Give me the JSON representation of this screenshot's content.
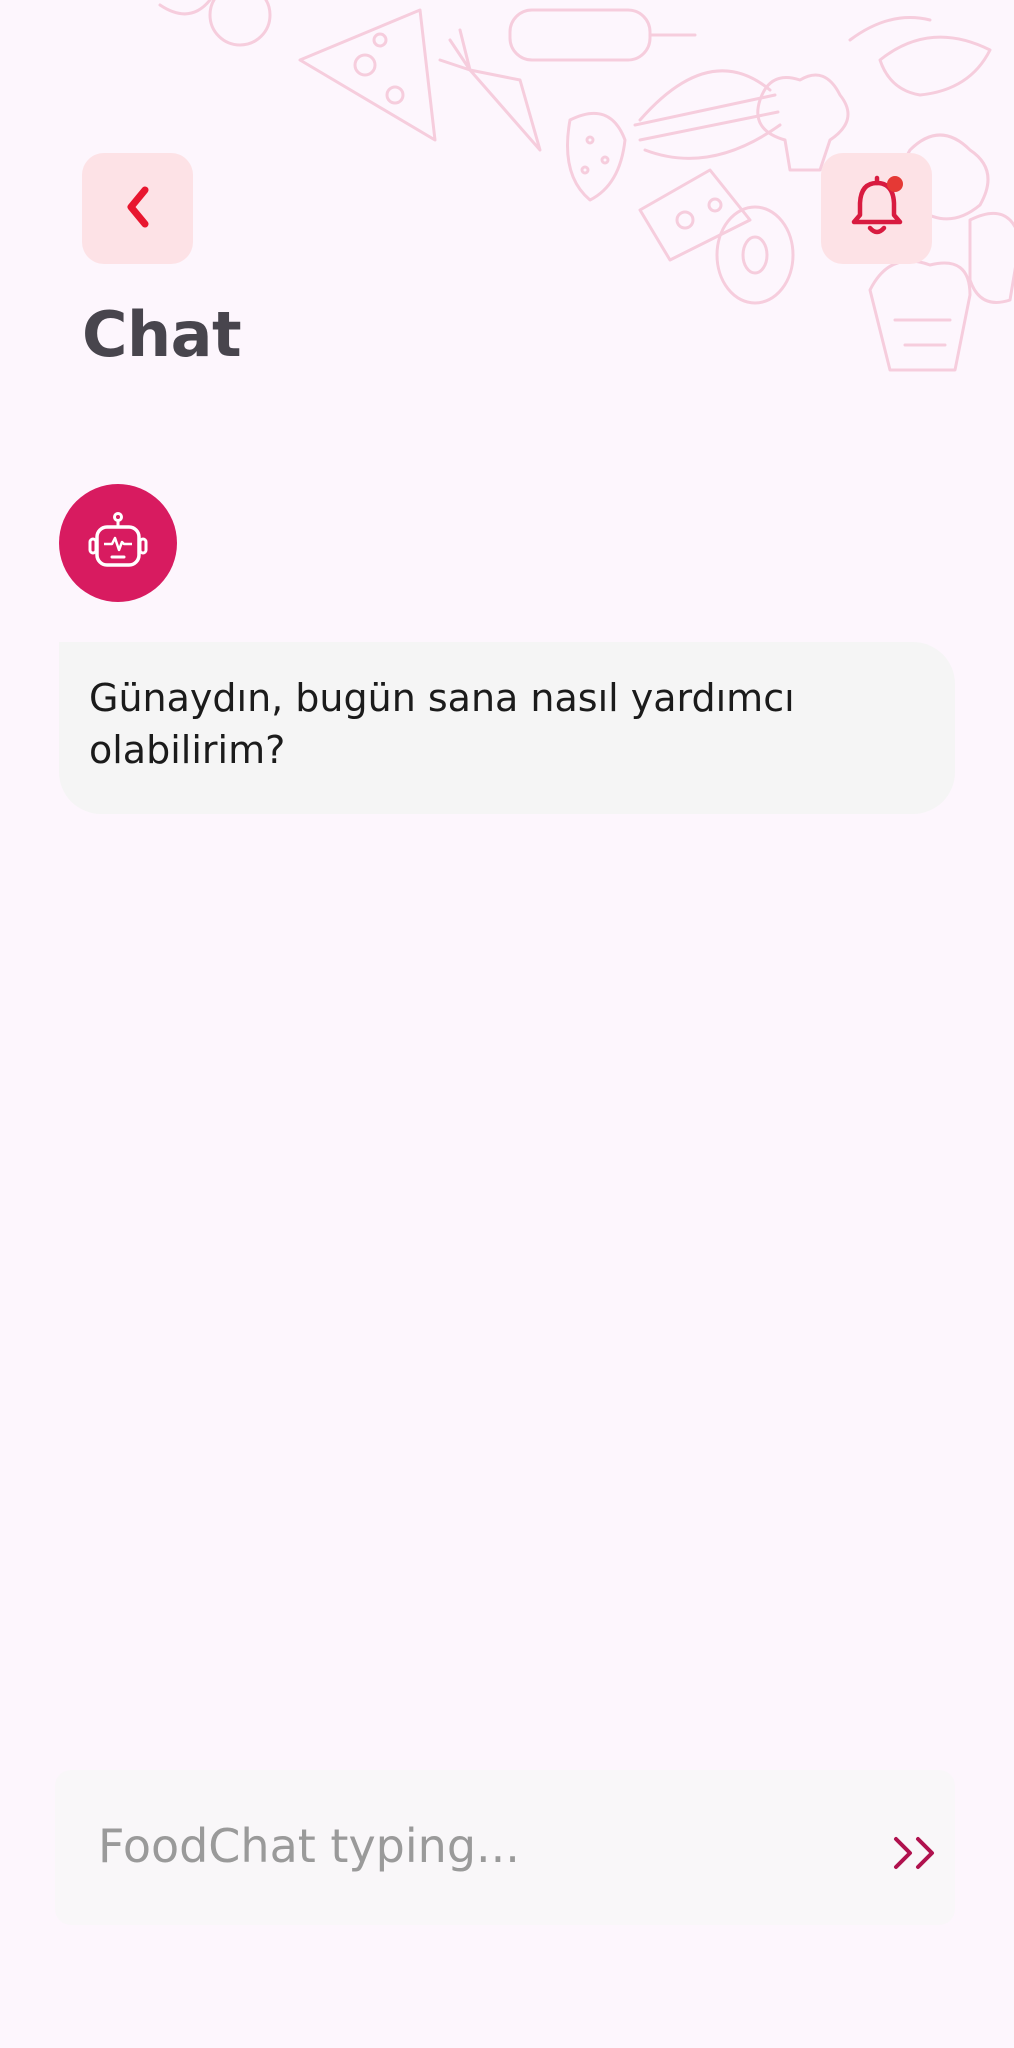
{
  "header": {
    "title": "Chat",
    "back_icon": "chevron-left-icon",
    "notification_icon": "bell-icon",
    "notification_dot_color": "#e53935"
  },
  "messages": [
    {
      "sender": "bot",
      "avatar_icon": "robot-icon",
      "text": "Günaydın, bugün sana nasıl yardımcı olabilirim?"
    }
  ],
  "composer": {
    "placeholder": "FoodChat typing...",
    "send_icon": "double-chevron-right-icon"
  },
  "colors": {
    "accent": "#d81b60",
    "icon_red": "#e8162f",
    "button_bg": "#fde2e6",
    "background": "#fdf6fd",
    "bubble_bg": "#f5f5f5"
  }
}
